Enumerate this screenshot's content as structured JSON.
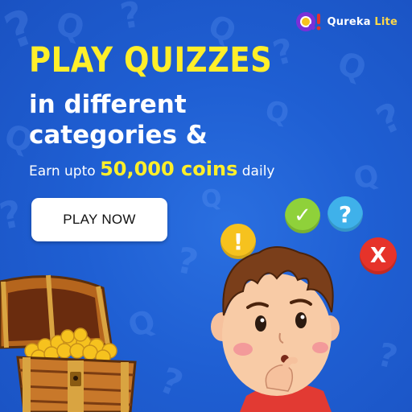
{
  "brand": {
    "name": "Qureka",
    "suffix": "Lite"
  },
  "headline": "PLAY QUIZZES",
  "subheadline_line1": "in different",
  "subheadline_line2": "categories &",
  "earn": {
    "prefix": "Earn upto",
    "amount": "50,000 coins",
    "suffix": "daily"
  },
  "cta_label": "PLAY NOW",
  "badges": {
    "exclaim": "!",
    "check": "✓",
    "question": "?",
    "cross": "X"
  },
  "colors": {
    "background": "#1f5fd3",
    "headline": "#ffef2a",
    "button": "#ffffff",
    "accent_yellow": "#f6c21e",
    "accent_green": "#8fd13a",
    "accent_blue": "#3fb1ea",
    "accent_red": "#e6332a"
  }
}
